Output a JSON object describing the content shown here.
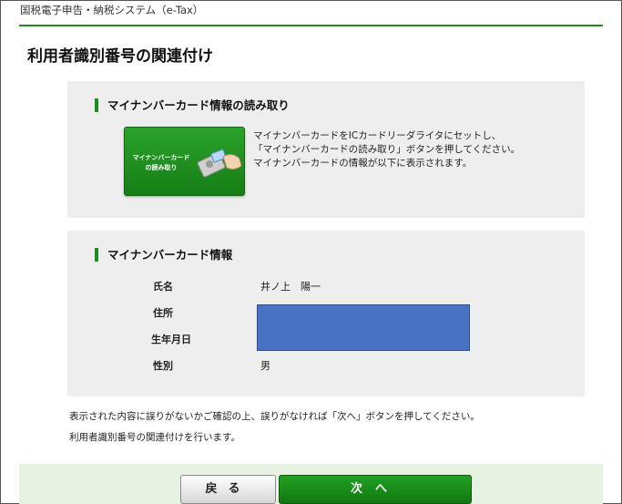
{
  "app": {
    "title": "国税電子申告・納税システム（e-Tax）"
  },
  "page": {
    "title": "利用者識別番号の関連付け"
  },
  "read_section": {
    "heading": "マイナンバーカード情報の読み取り",
    "button_line1": "マイナンバーカード",
    "button_line2": "の読み取り",
    "instructions": [
      "マイナンバーカードをICカードリーダライタにセットし、",
      "「マイナンバーカードの読み取り」ボタンを押してください。",
      "マイナンバーカードの情報が以下に表示されます。"
    ]
  },
  "info_section": {
    "heading": "マイナンバーカード情報",
    "name_label": "氏名",
    "name_value": "井ノ上　陽一",
    "address_label": "住所",
    "birthdate_label": "生年月日",
    "gender_label": "性別",
    "gender_value": "男",
    "redaction_color": "#4a72c4"
  },
  "notes": [
    "表示された内容に誤りがないかご確認の上、誤りがなければ「次へ」ボタンを押してください。",
    "利用者識別番号の関連付けを行います。"
  ],
  "footer": {
    "back_label": "戻る",
    "next_label": "次へ"
  },
  "colors": {
    "accent": "#1f8a1f",
    "panel_bg": "#eeeeee",
    "footer_bg": "#e6f2e2"
  }
}
